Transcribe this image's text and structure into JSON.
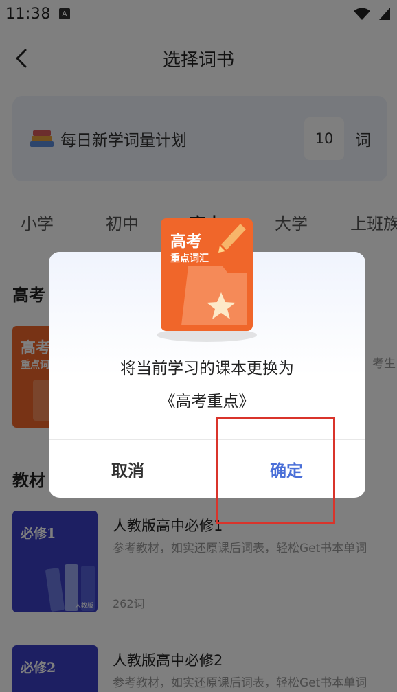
{
  "status": {
    "time": "11:38",
    "notif_letter": "A"
  },
  "header": {
    "title": "选择词书"
  },
  "plan": {
    "label": "每日新学词量计划",
    "count": "10",
    "unit": "词"
  },
  "tabs": [
    "小学",
    "初中",
    "高中",
    "大学",
    "上班族"
  ],
  "sections": {
    "gaokao": "高考",
    "textbook": "教材"
  },
  "gaokao_book": {
    "cover_title": "高考",
    "cover_subtitle": "重点词",
    "desc_tail": "考生"
  },
  "books": [
    {
      "cover_title": "必修1",
      "cover_badge": "人教版",
      "title": "人教版高中必修1",
      "desc": "参考教材，如实还原课后词表，轻松Get书本单词",
      "count": "262词",
      "cover_color": "#3a3fc4"
    },
    {
      "cover_title": "必修2",
      "title": "人教版高中必修2",
      "desc": "参考教材，如实还原课后词表，轻松Get书本单词",
      "cover_color": "#3a3fc4"
    }
  ],
  "modal": {
    "book_title": "高考",
    "book_subtitle": "重点词汇",
    "message": "将当前学习的课本更换为",
    "book_name": "《高考重点》",
    "cancel_label": "取消",
    "confirm_label": "确定",
    "book_color": "#f0662a"
  },
  "colors": {
    "accent": "#4a6fd8",
    "highlight": "#d9342b",
    "orange": "#f0662a",
    "blue": "#3a3fc4"
  }
}
